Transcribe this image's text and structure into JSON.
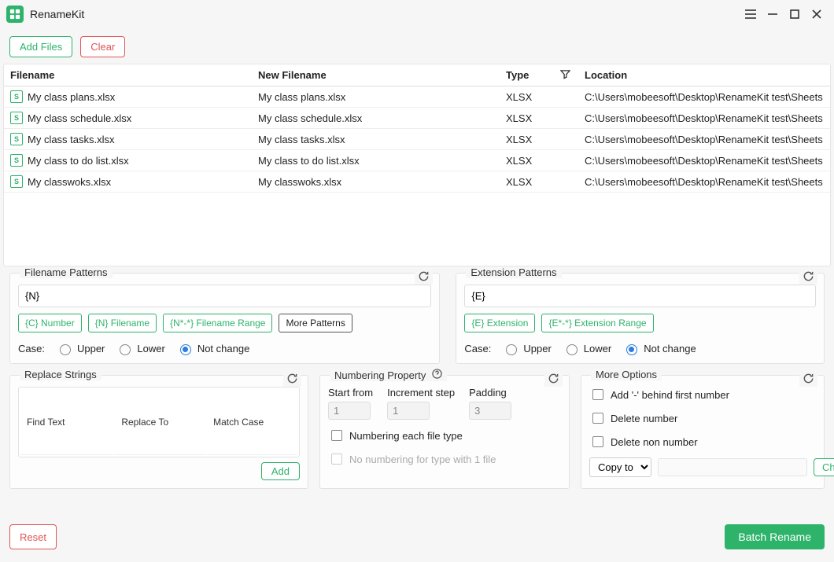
{
  "app": {
    "title": "RenameKit"
  },
  "toolbar": {
    "add_files": "Add Files",
    "clear": "Clear"
  },
  "table": {
    "headers": {
      "filename": "Filename",
      "new_filename": "New Filename",
      "type": "Type",
      "location": "Location"
    },
    "rows": [
      {
        "filename": "My class plans.xlsx",
        "new_filename": "My class plans.xlsx",
        "type": "XLSX",
        "location": "C:\\Users\\mobeesoft\\Desktop\\RenameKit test\\Sheets"
      },
      {
        "filename": "My class schedule.xlsx",
        "new_filename": "My class schedule.xlsx",
        "type": "XLSX",
        "location": "C:\\Users\\mobeesoft\\Desktop\\RenameKit test\\Sheets"
      },
      {
        "filename": "My class tasks.xlsx",
        "new_filename": "My class tasks.xlsx",
        "type": "XLSX",
        "location": "C:\\Users\\mobeesoft\\Desktop\\RenameKit test\\Sheets"
      },
      {
        "filename": "My class to do list.xlsx",
        "new_filename": "My class to do list.xlsx",
        "type": "XLSX",
        "location": "C:\\Users\\mobeesoft\\Desktop\\RenameKit test\\Sheets"
      },
      {
        "filename": "My classwoks.xlsx",
        "new_filename": "My classwoks.xlsx",
        "type": "XLSX",
        "location": "C:\\Users\\mobeesoft\\Desktop\\RenameKit test\\Sheets"
      }
    ]
  },
  "filename_patterns": {
    "title": "Filename Patterns",
    "value": "{N}",
    "chips": {
      "c_number": "{C} Number",
      "n_filename": "{N} Filename",
      "range": "{N*-*} Filename Range",
      "more": "More Patterns"
    },
    "case_label": "Case:",
    "case": {
      "upper": "Upper",
      "lower": "Lower",
      "nochange": "Not change"
    }
  },
  "extension_patterns": {
    "title": "Extension Patterns",
    "value": "{E}",
    "chips": {
      "e_ext": "{E} Extension",
      "range": "{E*-*} Extension Range"
    },
    "case_label": "Case:",
    "case": {
      "upper": "Upper",
      "lower": "Lower",
      "nochange": "Not change"
    }
  },
  "replace": {
    "title": "Replace Strings",
    "headers": {
      "find": "Find Text",
      "replace": "Replace To",
      "match": "Match Case"
    },
    "add": "Add"
  },
  "numbering": {
    "title": "Numbering Property",
    "start_label": "Start from",
    "start_value": "1",
    "step_label": "Increment step",
    "step_value": "1",
    "pad_label": "Padding",
    "pad_value": "3",
    "each_type": "Numbering each file type",
    "no_numbering_single": "No numbering for type with 1 file"
  },
  "more": {
    "title": "More Options",
    "add_dash": "Add '-' behind first number",
    "delete_number": "Delete number",
    "delete_non_number": "Delete non number",
    "action_selected": "Copy to",
    "change": "Change"
  },
  "footer": {
    "reset": "Reset",
    "batch_rename": "Batch Rename"
  }
}
